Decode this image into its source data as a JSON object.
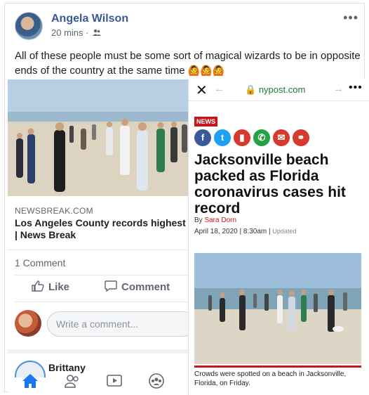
{
  "post": {
    "author": "Angela Wilson",
    "time": "20 mins",
    "privacy_icon": "friends-icon",
    "text": "All of these people must be some sort of magical wizards to be in opposite ends of the country at the same time",
    "emojis": "🙆🙆🙆"
  },
  "link": {
    "source": "NEWSBREAK.COM",
    "title_line1": "Los Angeles County records highest da",
    "title_line2": "| News Break"
  },
  "engagement": {
    "comment_count": "1 Comment",
    "like_label": "Like",
    "comment_label": "Comment",
    "comment_placeholder": "Write a comment...",
    "commenter": "Brittany"
  },
  "tabs": [
    "home-icon",
    "friends-icon",
    "watch-icon",
    "groups-icon"
  ],
  "article": {
    "url": "nypost.com",
    "tag": "NEWS",
    "headline": "Jacksonville beach packed as Florida coronavirus cases hit record",
    "by_prefix": "By",
    "author": "Sara Dorn",
    "date": "April 18, 2020",
    "time": "8:30am",
    "updated": "Updated",
    "caption": "Crowds were spotted on a beach in Jacksonville, Florida, on Friday."
  },
  "colors": {
    "facebook_blue": "#385898",
    "nypost_red": "#c4161c"
  }
}
